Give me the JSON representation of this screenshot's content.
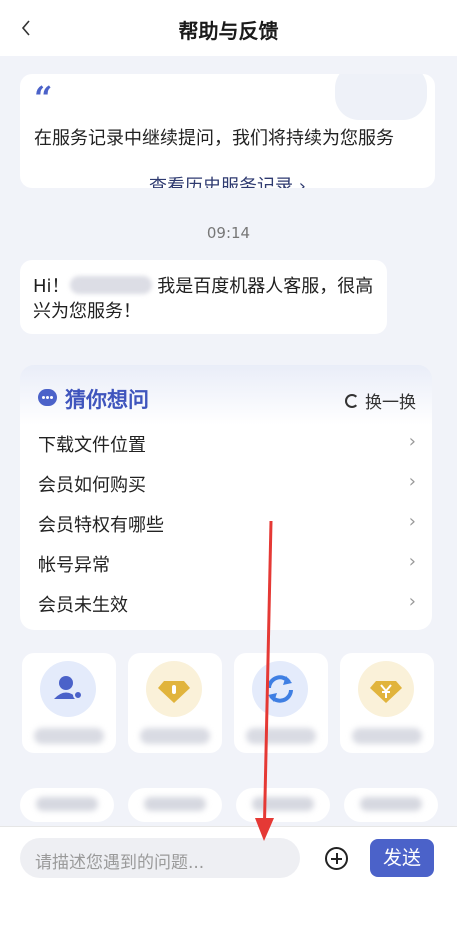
{
  "header": {
    "title": "帮助与反馈",
    "back_icon": "chevron-left-icon"
  },
  "quote_card": {
    "text": "在服务记录中继续提问，我们将持续为您服务",
    "history_link": "查看历史服务记录 ›"
  },
  "chat": {
    "time": "09:14",
    "greeting_prefix": "Hi！",
    "greeting_suffix": "我是百度机器人客服，很高兴为您服务！"
  },
  "faq": {
    "title": "猜你想问",
    "refresh_label": "换一换",
    "items": [
      {
        "label": "下载文件位置"
      },
      {
        "label": "会员如何购买"
      },
      {
        "label": "会员特权有哪些"
      },
      {
        "label": "帐号异常"
      },
      {
        "label": "会员未生效"
      }
    ]
  },
  "tiles": [
    {
      "icon": "user-gear-icon",
      "color": "#4b62c9"
    },
    {
      "icon": "diamond-icon",
      "color": "#e1b43c"
    },
    {
      "icon": "refresh-icon",
      "color": "#3f7fe3"
    },
    {
      "icon": "yuan-diamond-icon",
      "color": "#e1b43c"
    }
  ],
  "input": {
    "placeholder": "请描述您遇到的问题..."
  },
  "send_label": "发送",
  "colors": {
    "accent": "#4b62c9",
    "annotation_arrow": "#e53935"
  }
}
